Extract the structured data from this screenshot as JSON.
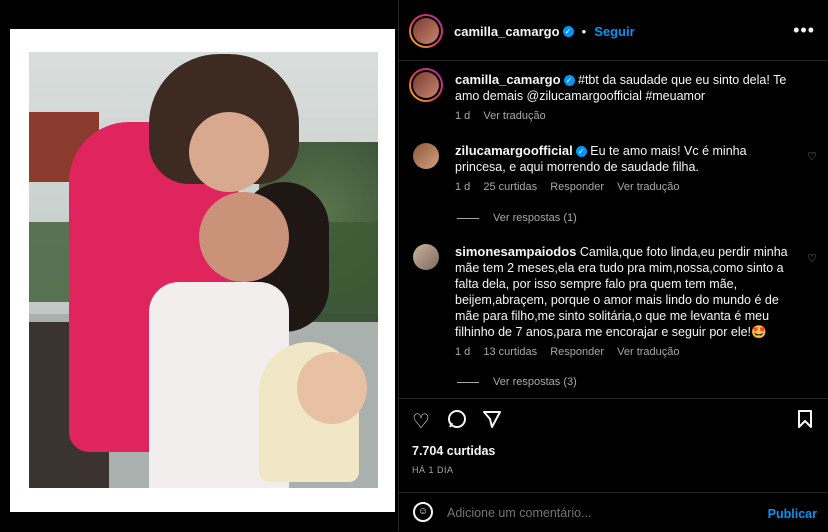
{
  "post": {
    "author": "camilla_camargo",
    "follow_label": "Seguir",
    "caption": "#tbt da saudade que eu sinto dela! Te amo demais @zilucamargoofficial #meuamor",
    "caption_time": "1 d",
    "caption_translate": "Ver tradução",
    "likes": "7.704 curtidas",
    "date": "HÁ 1 DIA"
  },
  "comments": [
    {
      "user": "zilucamargoofficial",
      "verified": true,
      "text": "Eu te amo mais! Vc é minha princesa, e aqui morrendo de saudade filha.",
      "time": "1 d",
      "likes": "25 curtidas",
      "reply": "Responder",
      "translate": "Ver tradução",
      "view_replies": "Ver respostas (1)"
    },
    {
      "user": "simonesampaiodos",
      "verified": false,
      "text": "Camila,que foto linda,eu perdir minha mãe tem 2 meses,ela era tudo pra mim,nossa,como sinto a falta dela, por isso sempre falo pra quem tem mãe, beijem,abraçem, porque o amor mais lindo do mundo é de mãe para filho,me sinto solitária,o que me levanta é meu filhinho de 7 anos,para me encorajar e seguir por ele!🤩",
      "time": "1 d",
      "likes": "13 curtidas",
      "reply": "Responder",
      "translate": "Ver tradução",
      "view_replies": "Ver respostas (3)"
    }
  ],
  "input": {
    "placeholder": "Adicione um comentário...",
    "publish": "Publicar"
  }
}
